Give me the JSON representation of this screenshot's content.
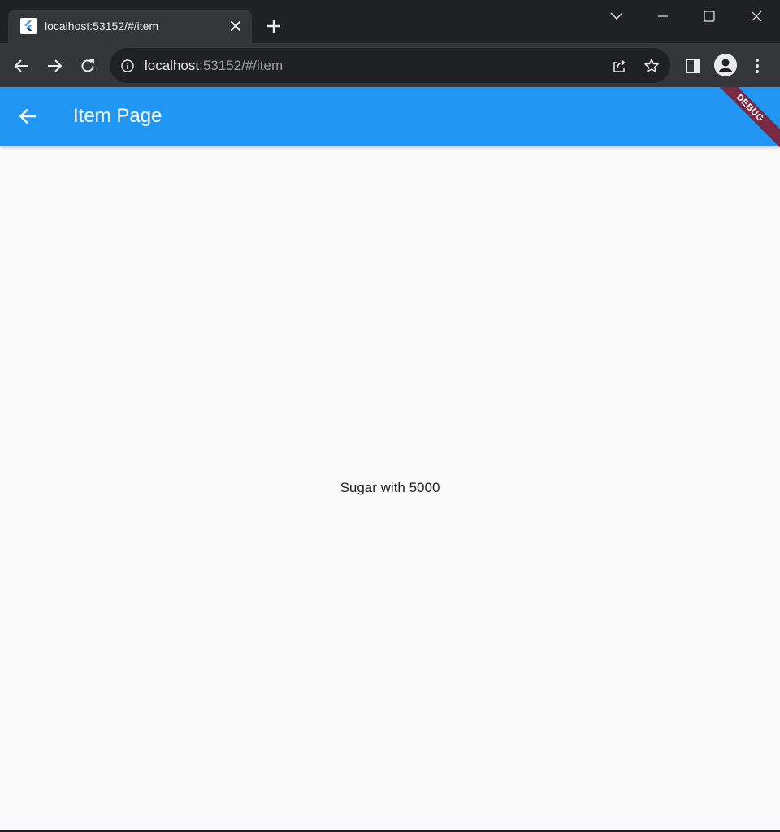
{
  "browser": {
    "tab": {
      "title": "localhost:53152/#/item"
    },
    "omnibox": {
      "host": "localhost",
      "path": ":53152/#/item"
    }
  },
  "app": {
    "title": "Item Page",
    "debug_label": "DEBUG",
    "body_text": "Sugar with 5000",
    "colors": {
      "appbar": "#2196f3",
      "background": "#fafafa",
      "debug_banner": "#7b2a45"
    }
  },
  "icons": {
    "tab_favicon": "flutter-icon",
    "tab_close": "close-icon",
    "new_tab": "plus-icon",
    "tab_search": "chevron-down-icon",
    "minimize": "minimize-icon",
    "maximize": "maximize-icon",
    "close_window": "close-window-icon",
    "back": "arrow-left-icon",
    "forward": "arrow-right-icon",
    "reload": "reload-icon",
    "site_info": "info-icon",
    "share": "share-icon",
    "bookmark": "star-icon",
    "side_panel": "side-panel-icon",
    "profile": "profile-icon",
    "menu": "more-vert-icon",
    "app_back": "arrow-left-icon"
  }
}
